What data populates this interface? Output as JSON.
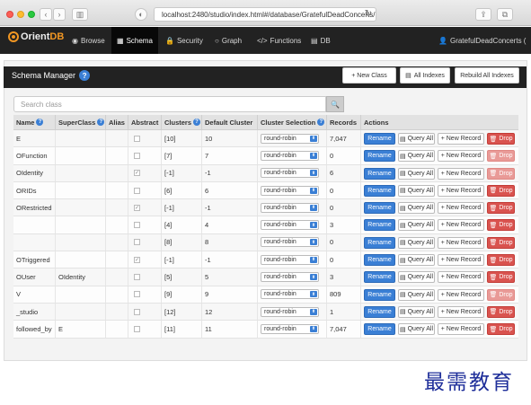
{
  "browser": {
    "address": "localhost:2480/studio/index.html#/database/GratefulDeadConcerts/",
    "back_glyph": "‹",
    "forward_glyph": "›",
    "reload_glyph": "↻",
    "share_glyph": "⇪",
    "newtab_glyph": "⧉",
    "sidebar_glyph": "▥",
    "tab_glyph": "◐"
  },
  "nav": {
    "brand_part1": "Orient",
    "brand_part2": "DB",
    "items": [
      {
        "label": "Browse",
        "icon": "eye-icon",
        "glyph": "◉"
      },
      {
        "label": "Schema",
        "icon": "table-icon",
        "glyph": "▦"
      },
      {
        "label": "Security",
        "icon": "lock-icon",
        "glyph": "🔒"
      },
      {
        "label": "Graph",
        "icon": "circle-icon",
        "glyph": "○"
      },
      {
        "label": "Functions",
        "icon": "code-icon",
        "glyph": "</>"
      },
      {
        "label": "DB",
        "icon": "database-icon",
        "glyph": "▤"
      }
    ],
    "user": "GratefulDeadConcerts (",
    "user_glyph": "👤"
  },
  "header": {
    "title": "Schema Manager",
    "help": "?",
    "new_class": "+ New Class",
    "all_indexes": "All Indexes",
    "all_indexes_glyph": "▤",
    "rebuild": "Rebuild All Indexes"
  },
  "search": {
    "placeholder": "Search class",
    "icon": "search-icon",
    "glyph": "🔍"
  },
  "table": {
    "columns": {
      "name": "Name",
      "superclass": "SuperClass",
      "alias": "Alias",
      "abstract": "Abstract",
      "clusters": "Clusters",
      "default_cluster": "Default Cluster",
      "cluster_selection": "Cluster Selection",
      "records": "Records",
      "actions": "Actions"
    },
    "help_glyph": "?",
    "check_glyph": "✓",
    "caret_glyph": "⬍",
    "action_labels": {
      "rename": "Rename",
      "query": "Query All",
      "query_glyph": "▤",
      "new_record": "+ New Record",
      "drop": "Drop",
      "drop_glyph": "🗑"
    },
    "rows": [
      {
        "name": "E",
        "superclass": "",
        "alias": "",
        "abstract": false,
        "clusters": "[10]",
        "default_cluster": "10",
        "selection": "round-robin",
        "records": "7,047"
      },
      {
        "name": "OFunction",
        "superclass": "",
        "alias": "",
        "abstract": false,
        "clusters": "[7]",
        "default_cluster": "7",
        "selection": "round-robin",
        "records": "0"
      },
      {
        "name": "OIdentity",
        "superclass": "",
        "alias": "",
        "abstract": true,
        "clusters": "[-1]",
        "default_cluster": "-1",
        "selection": "round-robin",
        "records": "6"
      },
      {
        "name": "ORIDs",
        "superclass": "",
        "alias": "",
        "abstract": false,
        "clusters": "[6]",
        "default_cluster": "6",
        "selection": "round-robin",
        "records": "0"
      },
      {
        "name": "ORestricted",
        "superclass": "",
        "alias": "",
        "abstract": true,
        "clusters": "[-1]",
        "default_cluster": "-1",
        "selection": "round-robin",
        "records": "0"
      },
      {
        "name": "",
        "superclass": "",
        "alias": "",
        "abstract": false,
        "clusters": "[4]",
        "default_cluster": "4",
        "selection": "round-robin",
        "records": "3"
      },
      {
        "name": "",
        "superclass": "",
        "alias": "",
        "abstract": false,
        "clusters": "[8]",
        "default_cluster": "8",
        "selection": "round-robin",
        "records": "0"
      },
      {
        "name": "OTriggered",
        "superclass": "",
        "alias": "",
        "abstract": true,
        "clusters": "[-1]",
        "default_cluster": "-1",
        "selection": "round-robin",
        "records": "0"
      },
      {
        "name": "OUser",
        "superclass": "OIdentity",
        "alias": "",
        "abstract": false,
        "clusters": "[5]",
        "default_cluster": "5",
        "selection": "round-robin",
        "records": "3"
      },
      {
        "name": "V",
        "superclass": "",
        "alias": "",
        "abstract": false,
        "clusters": "[9]",
        "default_cluster": "9",
        "selection": "round-robin",
        "records": "809"
      },
      {
        "name": "_studio",
        "superclass": "",
        "alias": "",
        "abstract": false,
        "clusters": "[12]",
        "default_cluster": "12",
        "selection": "round-robin",
        "records": "1"
      },
      {
        "name": "followed_by",
        "superclass": "E",
        "alias": "",
        "abstract": false,
        "clusters": "[11]",
        "default_cluster": "11",
        "selection": "round-robin",
        "records": "7,047"
      }
    ]
  },
  "watermark": {
    "text": "最需教育"
  },
  "colors": {
    "navbar": "#222222",
    "brand_accent": "#f29723",
    "primary": "#3a7fd5",
    "danger": "#d9534f"
  }
}
